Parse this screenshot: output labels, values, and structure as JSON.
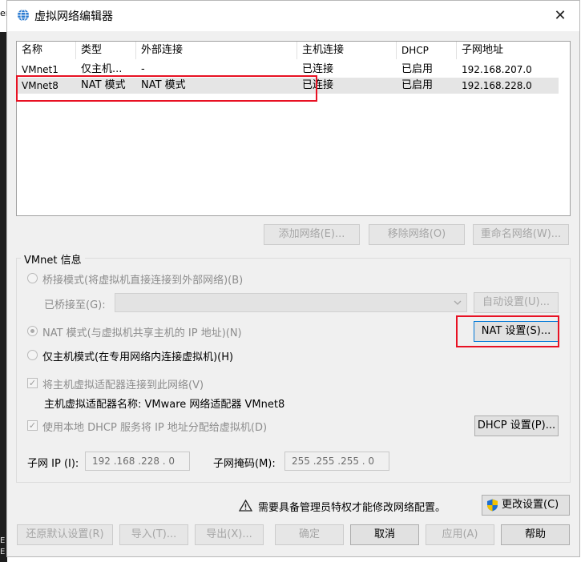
{
  "background": {
    "fragment_top": "er",
    "fragment_bottom1": "E",
    "fragment_bottom2": "E"
  },
  "window": {
    "title": "虚拟网络编辑器",
    "close_glyph": "✕"
  },
  "network_table": {
    "headers": [
      "名称",
      "类型",
      "外部连接",
      "主机连接",
      "DHCP",
      "子网地址"
    ],
    "rows": [
      {
        "name": "VMnet1",
        "type": "仅主机...",
        "external": "-",
        "host": "已连接",
        "dhcp": "已启用",
        "subnet": "192.168.207.0"
      },
      {
        "name": "VMnet8",
        "type": "NAT 模式",
        "external": "NAT 模式",
        "host": "已连接",
        "dhcp": "已启用",
        "subnet": "192.168.228.0",
        "selected": true
      }
    ]
  },
  "table_buttons": {
    "add": "添加网络(E)...",
    "remove": "移除网络(O)",
    "rename": "重命名网络(W)..."
  },
  "vmnet_info": {
    "legend": "VMnet 信息",
    "bridge_mode": "桥接模式(将虚拟机直接连接到外部网络)(B)",
    "bridged_to_label": "已桥接至(G):",
    "auto_settings": "自动设置(U)...",
    "nat_mode": "NAT 模式(与虚拟机共享主机的 IP 地址)(N)",
    "nat_settings": "NAT 设置(S)...",
    "host_only_mode": "仅主机模式(在专用网络内连接虚拟机)(H)",
    "connect_adapter": "将主机虚拟适配器连接到此网络(V)",
    "adapter_name": "主机虚拟适配器名称: VMware 网络适配器 VMnet8",
    "use_dhcp": "使用本地 DHCP 服务将 IP 地址分配给虚拟机(D)",
    "dhcp_settings": "DHCP 设置(P)...",
    "subnet_ip_label": "子网 IP (I):",
    "subnet_ip": "192 .168 .228 .  0",
    "subnet_mask_label": "子网掩码(M):",
    "subnet_mask": "255 .255 .255 .  0"
  },
  "admin": {
    "warning_text": "需要具备管理员特权才能修改网络配置。",
    "change_settings": "更改设置(C)"
  },
  "footer": {
    "restore_defaults": "还原默认设置(R)",
    "import": "导入(T)...",
    "export": "导出(X)...",
    "ok": "确定",
    "cancel": "取消",
    "apply": "应用(A)",
    "help": "帮助"
  },
  "colors": {
    "highlight_red": "#e81123",
    "selected_row": "#e5e5e5",
    "dialog_bg": "#f0f0f0"
  }
}
